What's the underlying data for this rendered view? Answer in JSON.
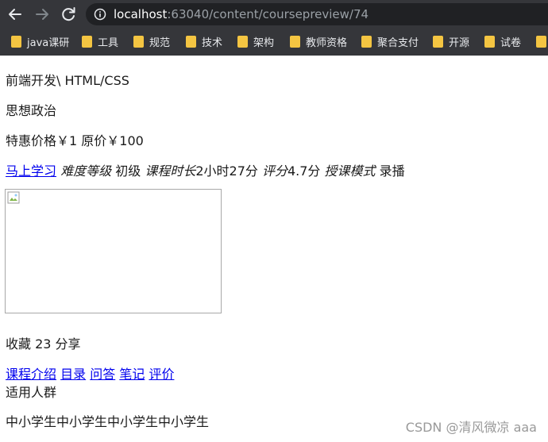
{
  "browser": {
    "url_host": "localhost",
    "url_rest": ":63040/content/coursepreview/74",
    "bookmarks": [
      "java课研",
      "工具",
      "规范",
      "技术",
      "架构",
      "教师资格",
      "聚合支付",
      "开源",
      "试卷"
    ]
  },
  "page": {
    "category": "前端开发\\ HTML/CSS",
    "course_name": "思想政治",
    "price_text": "特惠价格￥1 原价￥100",
    "learn_link": "马上学习",
    "difficulty_label": "难度等级",
    "difficulty_value": " 初级 ",
    "duration_label": "课程时长",
    "duration_value": "2小时27分 ",
    "rating_label": "评分",
    "rating_value": "4.7分 ",
    "mode_label": "授课模式",
    "mode_value": " 录播",
    "favorites_text": "收藏 23 分享",
    "tabs": [
      "课程介绍",
      "目录",
      "问答",
      "笔记",
      "评价"
    ],
    "audience_title": "适用人群",
    "audience_value": "中小学生中小学生中小学生中小学生"
  },
  "watermark": "CSDN @清风微凉 aaa",
  "colors": {
    "chrome_bg": "#35363a",
    "link": "#0000ee",
    "folder": "#f4c542"
  }
}
